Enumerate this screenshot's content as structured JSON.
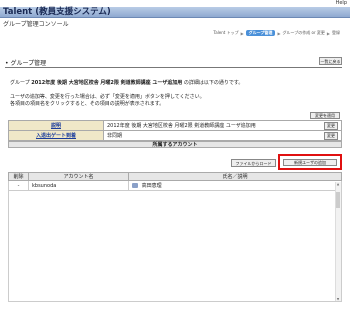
{
  "header": {
    "help": "Help",
    "app_title": "Talent (教員支援システム)",
    "subtitle": "グループ管理コンソール"
  },
  "breadcrumb": {
    "items": [
      "Talent トップ",
      "グループ管理",
      "グループの作成 or 変更",
      "登録"
    ],
    "active_index": 1
  },
  "section": {
    "title": "• グループ管理",
    "back_label": "一覧に戻る"
  },
  "description": {
    "line1_prefix": "グループ",
    "line1_group": "2012年度 後期 大宮地区校舎 月曜2限 剣道教師講座 ユーザ追加用",
    "line1_suffix": "の詳細は以下の通りです。",
    "line2": "ユーザの追加等、変更を行った場合は、必ず「変更を適用」ボタンを押してください。",
    "line3": "各項目の項目名をクリックすると、その項目の説明が表示されます。"
  },
  "info": {
    "apply_label": "変更を適用",
    "rows": [
      {
        "label": "説明",
        "value": "2012年度 後期 大宮地区校舎 月曜2限 剣道教師講座 ユーザ追加用",
        "button": "変更"
      },
      {
        "label": "入退出ゲート到着",
        "value": "非同期",
        "button": "変更"
      }
    ]
  },
  "members": {
    "heading": "所属するアカウント",
    "file_load_label": "ファイルからロード",
    "new_user_label": "新規ユーザの追加",
    "columns": {
      "delete": "削除",
      "account": "アカウント名",
      "name": "氏名／説明"
    },
    "rows": [
      {
        "delete": "-",
        "account": "kbsunoda",
        "name": "高田恵理"
      }
    ]
  }
}
